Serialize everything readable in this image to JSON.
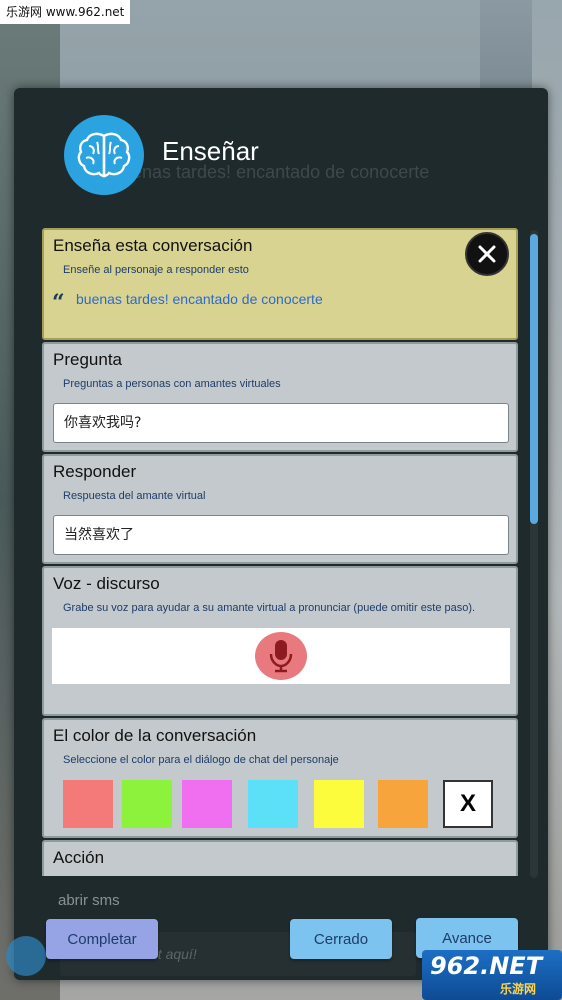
{
  "watermark": {
    "site": "乐游网 www.962.net"
  },
  "header": {
    "title": "Enseñar",
    "ghost_text": "enas tardes! encantado de conocerte"
  },
  "teach_card": {
    "title": "Enseña esta conversación",
    "subtitle": "Enseñe al personaje a responder esto",
    "quote_mark": "“",
    "quote": "buenas tardes! encantado de conocerte"
  },
  "question_card": {
    "title": "Pregunta",
    "subtitle": "Preguntas a personas con amantes virtuales",
    "value": "你喜欢我吗?"
  },
  "response_card": {
    "title": "Responder",
    "subtitle": "Respuesta del amante virtual",
    "value": "当然喜欢了"
  },
  "voice_card": {
    "title": "Voz - discurso",
    "subtitle": "Grabe su voz para ayudar a su amante virtual a pronunciar (puede omitir este paso)."
  },
  "color_card": {
    "title": "El color de la conversación",
    "subtitle": "Seleccione el color para el diálogo de chat del personaje",
    "colors": [
      "#f47a7a",
      "#8cf23c",
      "#f06ef0",
      "#5ce0f8",
      "#fcfc3c",
      "#f8a43c"
    ],
    "clear_label": "X"
  },
  "action_card": {
    "title": "Acción"
  },
  "background_text": {
    "sms": "abrir sms",
    "input_hint": "et aquí!"
  },
  "buttons": {
    "complete": "Completar",
    "closed": "Cerrado",
    "advance": "Avance"
  },
  "logo": {
    "main": "962.NET",
    "sub": "乐游网"
  }
}
